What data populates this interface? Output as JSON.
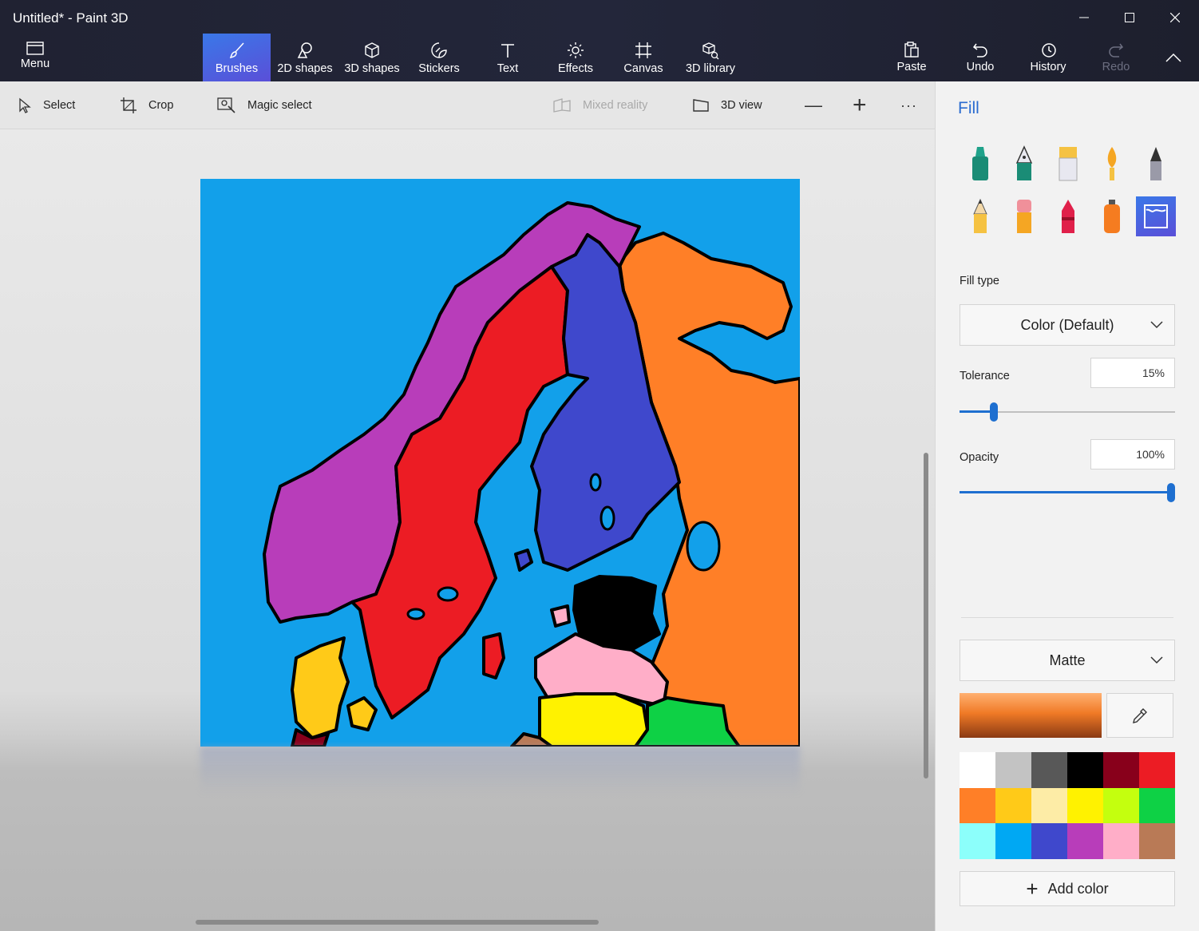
{
  "window": {
    "title": "Untitled* - Paint 3D"
  },
  "ribbon": {
    "menu_label": "Menu",
    "tools": [
      {
        "label": "Brushes",
        "icon": "brush-icon",
        "active": true
      },
      {
        "label": "2D shapes",
        "icon": "2d-shapes-icon"
      },
      {
        "label": "3D shapes",
        "icon": "3d-cube-icon"
      },
      {
        "label": "Stickers",
        "icon": "sticker-icon"
      },
      {
        "label": "Text",
        "icon": "text-icon"
      },
      {
        "label": "Effects",
        "icon": "sun-icon"
      },
      {
        "label": "Canvas",
        "icon": "canvas-icon"
      },
      {
        "label": "3D library",
        "icon": "3d-library-icon"
      }
    ],
    "actions": [
      {
        "label": "Paste",
        "icon": "paste-icon"
      },
      {
        "label": "Undo",
        "icon": "undo-icon"
      },
      {
        "label": "History",
        "icon": "history-icon"
      },
      {
        "label": "Redo",
        "icon": "redo-icon",
        "disabled": true
      }
    ]
  },
  "subtoolbar": {
    "select": "Select",
    "crop": "Crop",
    "magic_select": "Magic select",
    "mixed_reality": "Mixed reality",
    "view_3d": "3D view",
    "zoom_out": "—",
    "zoom_in": "+",
    "more": "···"
  },
  "panel": {
    "title": "Fill",
    "brushes": [
      "marker-icon",
      "calligraphy-pen-icon",
      "oil-brush-icon",
      "watercolor-icon",
      "pixel-pen-icon",
      "pencil-icon",
      "eraser-icon",
      "crayon-icon",
      "spray-can-icon",
      "fill-bucket-icon"
    ],
    "selected_brush": "fill-bucket-icon",
    "fill_type_label": "Fill type",
    "fill_type_value": "Color (Default)",
    "tolerance_label": "Tolerance",
    "tolerance_value": "15%",
    "tolerance_level": 0.16,
    "opacity_label": "Opacity",
    "opacity_value": "100%",
    "opacity_level": 1.0,
    "finish_value": "Matte",
    "current_color": "#f07a26",
    "palette": [
      "#ffffff",
      "#c3c3c3",
      "#585858",
      "#000000",
      "#88001b",
      "#ec1c24",
      "#ff7f27",
      "#ffca18",
      "#fdeca6",
      "#fff200",
      "#c4ff0e",
      "#0ed145",
      "#8cfffb",
      "#00a8f3",
      "#3f48cc",
      "#b83dba",
      "#ffaec8",
      "#b97a56"
    ],
    "add_color_label": "Add color"
  },
  "canvas": {
    "background": "#12a0ea",
    "region_colors": {
      "norway": "#b83dba",
      "sweden": "#ec1c24",
      "finland": "#3f48cc",
      "russia": "#ff7f27",
      "estonia": "#000000",
      "latvia": "#ffaec8",
      "lithuania": "#fff200",
      "belarus": "#0ed145",
      "denmark": "#ffca18",
      "germany": "#88001b",
      "poland": "#b97a56"
    }
  }
}
